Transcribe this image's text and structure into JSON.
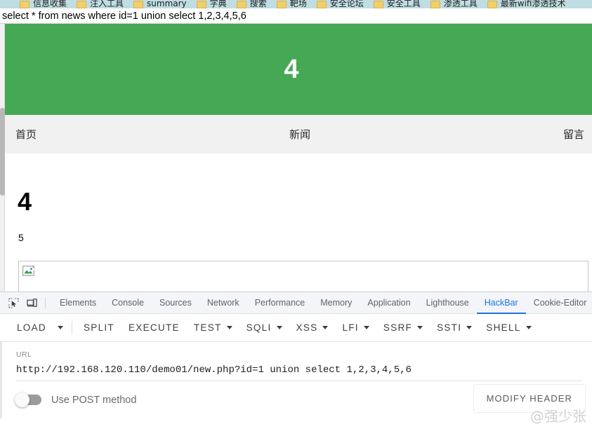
{
  "browser": {
    "bookmarks": [
      {
        "label": "信息收集"
      },
      {
        "label": "注入工具"
      },
      {
        "label": "summary"
      },
      {
        "label": "字典"
      },
      {
        "label": "搜索"
      },
      {
        "label": "靶场"
      },
      {
        "label": "安全论坛"
      },
      {
        "label": "安全工具"
      },
      {
        "label": "渗透工具"
      },
      {
        "label": "最新wifi渗透技术"
      }
    ]
  },
  "page": {
    "query_echo": "select * from news where id=1 union select 1,2,3,4,5,6",
    "banner_text": "4",
    "banner_color": "#45a854",
    "nav": [
      {
        "label": "首页"
      },
      {
        "label": "新闻"
      },
      {
        "label": "留言"
      }
    ],
    "heading": "4",
    "paragraph": "5",
    "broken_image_alt": ""
  },
  "devtools": {
    "icons": [
      {
        "name": "inspect-element-icon"
      },
      {
        "name": "device-toolbar-icon"
      }
    ],
    "tabs": [
      {
        "label": "Elements",
        "active": false
      },
      {
        "label": "Console",
        "active": false
      },
      {
        "label": "Sources",
        "active": false
      },
      {
        "label": "Network",
        "active": false
      },
      {
        "label": "Performance",
        "active": false
      },
      {
        "label": "Memory",
        "active": false
      },
      {
        "label": "Application",
        "active": false
      },
      {
        "label": "Lighthouse",
        "active": false
      },
      {
        "label": "HackBar",
        "active": true
      },
      {
        "label": "Cookie-Editor",
        "active": false
      }
    ],
    "active_tab_color": "#1a73e8"
  },
  "hackbar": {
    "toolbar": [
      {
        "label": "LOAD",
        "caret": false
      },
      {
        "label": "",
        "caret": true,
        "caret_only": true
      },
      {
        "label": "SPLIT",
        "caret": false
      },
      {
        "label": "EXECUTE",
        "caret": false
      },
      {
        "label": "TEST",
        "caret": true
      },
      {
        "label": "SQLI",
        "caret": true
      },
      {
        "label": "XSS",
        "caret": true
      },
      {
        "label": "LFI",
        "caret": true
      },
      {
        "label": "SSRF",
        "caret": true
      },
      {
        "label": "SSTI",
        "caret": true
      },
      {
        "label": "SHELL",
        "caret": true
      }
    ],
    "url_label": "URL",
    "url_value": "http://192.168.120.110/demo01/new.php?id=1 union select 1,2,3,4,5,6",
    "post_toggle_label": "Use POST method",
    "post_toggle_on": false,
    "modify_header_label": "MODIFY HEADER"
  },
  "watermark": "@强少张"
}
